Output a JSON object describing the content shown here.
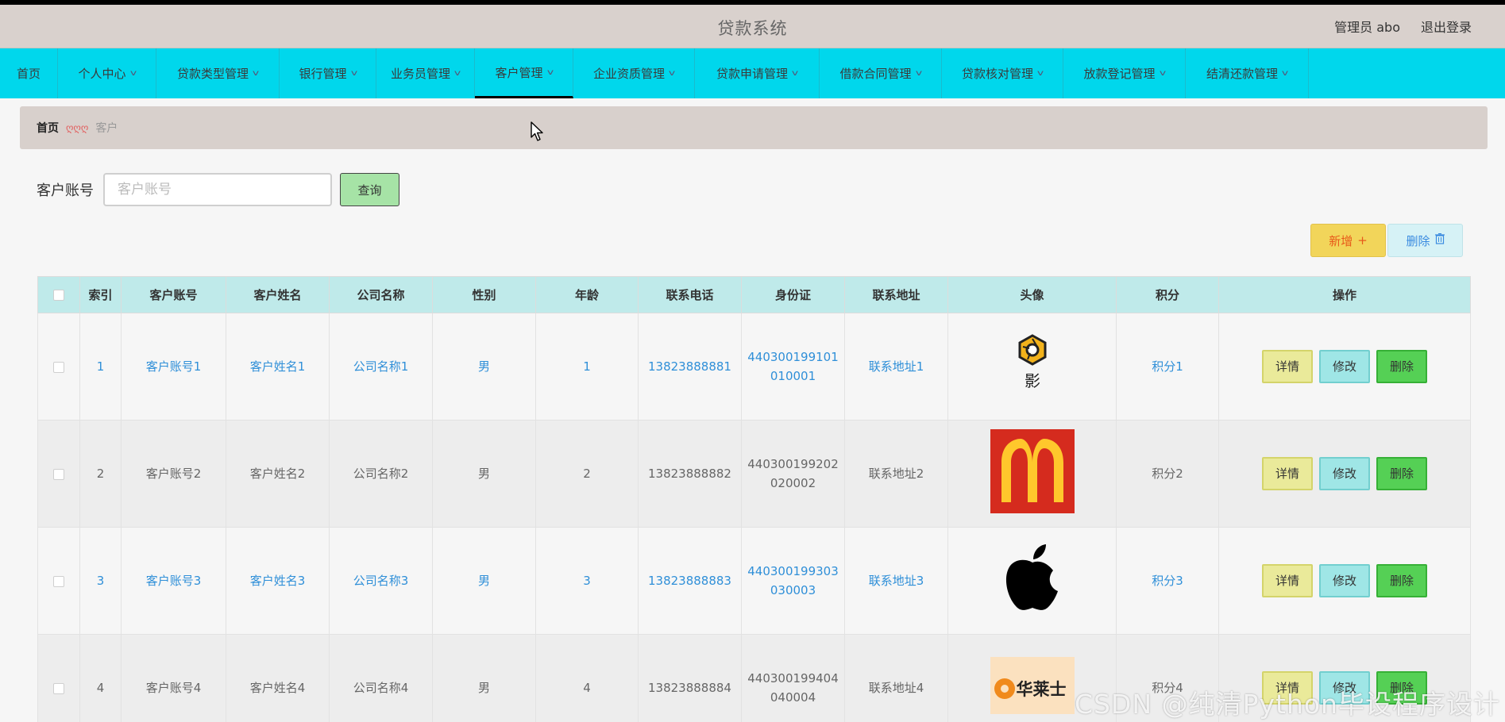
{
  "header": {
    "title": "贷款系统",
    "user_label": "管理员 abo",
    "logout_label": "退出登录"
  },
  "nav": {
    "items": [
      {
        "label": "首页"
      },
      {
        "label": "个人中心"
      },
      {
        "label": "贷款类型管理"
      },
      {
        "label": "银行管理"
      },
      {
        "label": "业务员管理"
      },
      {
        "label": "客户管理"
      },
      {
        "label": "企业资质管理"
      },
      {
        "label": "贷款申请管理"
      },
      {
        "label": "借款合同管理"
      },
      {
        "label": "贷款核对管理"
      },
      {
        "label": "放款登记管理"
      },
      {
        "label": "结清还款管理"
      }
    ],
    "active": "客户管理"
  },
  "breadcrumb": {
    "home": "首页",
    "separator": "ღღღ",
    "current": "客户"
  },
  "search": {
    "label": "客户账号",
    "placeholder": "客户账号",
    "value": "",
    "button_label": "查询"
  },
  "actions": {
    "add_label": "新增",
    "delete_label": "删除"
  },
  "table": {
    "columns": [
      "索引",
      "客户账号",
      "客户姓名",
      "公司名称",
      "性别",
      "年龄",
      "联系电话",
      "身份证",
      "联系地址",
      "头像",
      "积分",
      "操作"
    ],
    "rows": [
      {
        "index": "1",
        "account": "客户账号1",
        "name": "客户姓名1",
        "company": "公司名称1",
        "gender": "男",
        "age": "1",
        "phone": "13823888881",
        "id_card": "440300199101010001",
        "address": "联系地址1",
        "avatar": "camera-logo",
        "points": "积分1"
      },
      {
        "index": "2",
        "account": "客户账号2",
        "name": "客户姓名2",
        "company": "公司名称2",
        "gender": "男",
        "age": "2",
        "phone": "13823888882",
        "id_card": "440300199202020002",
        "address": "联系地址2",
        "avatar": "mcdonalds-logo",
        "points": "积分2"
      },
      {
        "index": "3",
        "account": "客户账号3",
        "name": "客户姓名3",
        "company": "公司名称3",
        "gender": "男",
        "age": "3",
        "phone": "13823888883",
        "id_card": "440300199303030003",
        "address": "联系地址3",
        "avatar": "apple-logo",
        "points": "积分3"
      },
      {
        "index": "4",
        "account": "客户账号4",
        "name": "客户姓名4",
        "company": "公司名称4",
        "gender": "男",
        "age": "4",
        "phone": "13823888884",
        "id_card": "440300199404040004",
        "address": "联系地址4",
        "avatar": "wallace-logo",
        "points": "积分4"
      }
    ],
    "row_actions": {
      "detail": "详情",
      "edit": "修改",
      "delete": "删除"
    }
  },
  "logos": {
    "camera": "影",
    "wallace": "华莱士"
  },
  "watermark": "CSDN @纯清Python毕设程序设计",
  "colors": {
    "nav_bg": "#00d7ec",
    "header_bg": "#d9d1cd",
    "link_blue": "#2f8fd8",
    "table_header_bg": "#bfeaea",
    "add_button": "#f2d55a",
    "delete_button": "#55d055"
  }
}
